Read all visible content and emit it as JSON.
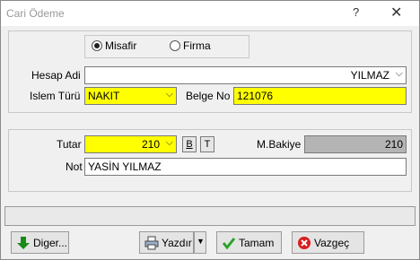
{
  "window": {
    "title": "Cari Ödeme",
    "help_glyph": "?",
    "close_glyph": "✕"
  },
  "party_type": {
    "options": [
      "Misafir",
      "Firma"
    ],
    "selected": "Misafir"
  },
  "hesap": {
    "label": "Hesap Adi",
    "value": "YILMAZ"
  },
  "islem": {
    "label": "Islem Türü",
    "value": "NAKIT"
  },
  "belge": {
    "label": "Belge No",
    "value": "121076"
  },
  "tutar": {
    "label": "Tutar",
    "value": "210",
    "bold_btn": "B",
    "t_btn": "T"
  },
  "bakiye": {
    "label": "M.Bakiye",
    "value": "210"
  },
  "note": {
    "label": "Not",
    "value": "YASİN YILMAZ"
  },
  "buttons": {
    "diger": "Diger...",
    "yazdir": "Yazdır",
    "tamam": "Tamam",
    "vazgec": "Vazgeç"
  },
  "colors": {
    "required_field": "#ffff00",
    "readonly_field": "#b4b4b4"
  },
  "icons": [
    "help-icon",
    "close-icon",
    "chevron-down-icon",
    "arrow-down-icon",
    "print-icon",
    "checkmark-icon",
    "cancel-icon"
  ]
}
